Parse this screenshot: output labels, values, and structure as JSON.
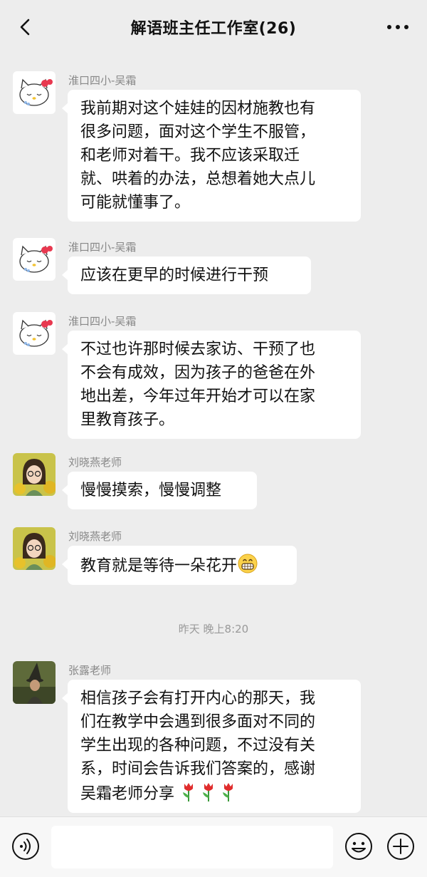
{
  "header": {
    "title": "解语班主任工作室(26)"
  },
  "messages": [
    {
      "sender": "淮口四小-吴霜",
      "lines": [
        "我前期对这个娃娃的因材施教也有",
        "很多问题，面对这个学生不服管，",
        "和老师对着干。我不应该采取迁",
        "就、哄着的办法，总想着她大点儿",
        "可能就懂事了。"
      ]
    },
    {
      "sender": "淮口四小-吴霜",
      "lines": [
        "应该在更早的时候进行干预"
      ]
    },
    {
      "sender": "淮口四小-吴霜",
      "lines": [
        "不过也许那时候去家访、干预了也",
        "不会有成效，因为孩子的爸爸在外",
        "地出差，今年过年开始才可以在家",
        "里教育孩子。"
      ]
    },
    {
      "sender": "刘晓燕老师",
      "lines": [
        "慢慢摸索，慢慢调整"
      ]
    },
    {
      "sender": "刘晓燕老师",
      "lines": [
        "教育就是等待一朵花开"
      ],
      "emoji": "grin-emoji"
    },
    {
      "sender": "张露老师",
      "lines": [
        "相信孩子会有打开内心的那天，我",
        "们在教学中会遇到很多面对不同的",
        "学生出现的各种问题，不过没有关",
        "系，时间会告诉我们答案的，感谢",
        "吴霜老师分享"
      ],
      "emoji": "tulip-emoji"
    }
  ],
  "timestamp": "昨天 晚上8:20",
  "colors": {
    "background": "#ededed",
    "bubble": "#ffffff",
    "meta_text": "#888888"
  }
}
